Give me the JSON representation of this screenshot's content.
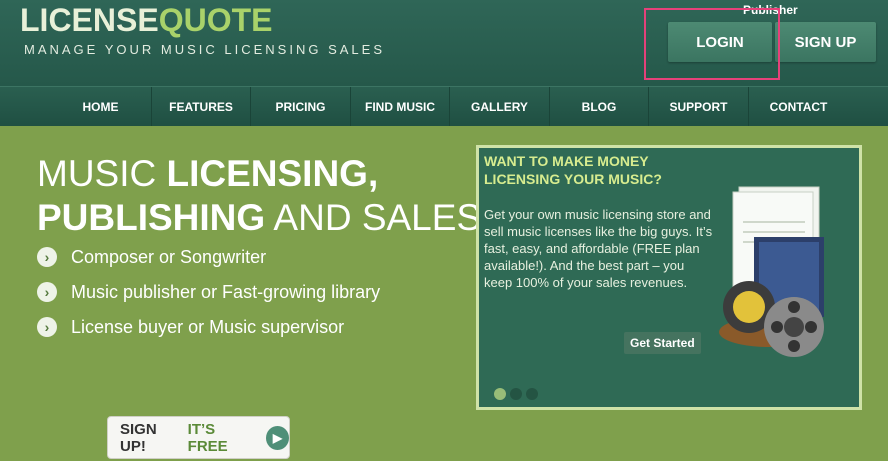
{
  "logo": {
    "part1": "LICENSE",
    "part2": "QUOTE"
  },
  "tagline": "MANAGE YOUR MUSIC LICENSING SALES",
  "publisher_label": "Publisher",
  "auth": {
    "login": "LOGIN",
    "signup": "SIGN UP"
  },
  "nav": [
    "HOME",
    "FEATURES",
    "PRICING",
    "FIND MUSIC",
    "GALLERY",
    "BLOG",
    "SUPPORT",
    "CONTACT"
  ],
  "hero": {
    "line1_a": "MUSIC ",
    "line1_b": "LICENSING,",
    "line2_a": "PUBLISHING",
    "line2_b": " AND SALES",
    "bullets": [
      "Composer or Songwriter",
      "Music publisher or Fast-growing library",
      "License buyer or Music supervisor"
    ]
  },
  "promo": {
    "title": "WANT TO MAKE MONEY LICENSING YOUR MUSIC?",
    "text": "Get your own music licensing store and sell music licenses like the big guys. It’s fast, easy, and affordable (FREE plan available!). And the best part – you keep 100% of your sales revenues.",
    "cta": "Get Started",
    "slides": 3,
    "active_slide": 1
  },
  "signup_cta": {
    "a": "SIGN UP!",
    "b": "IT’S FREE"
  }
}
